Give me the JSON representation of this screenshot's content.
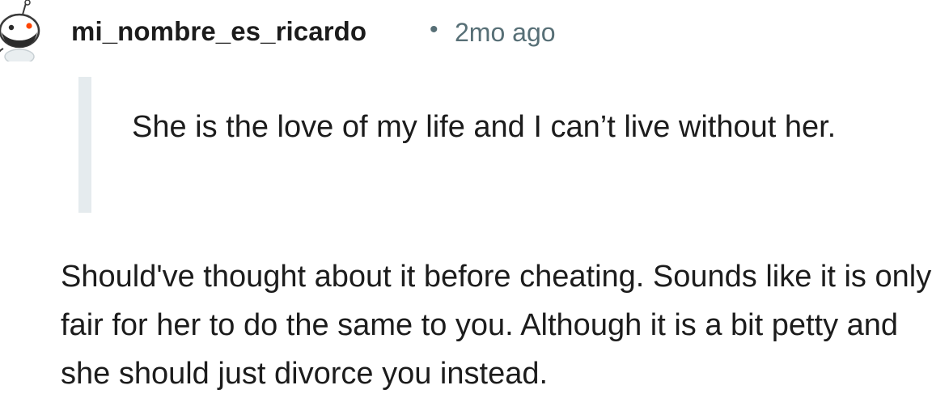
{
  "comment": {
    "author": "mi_nombre_es_ricardo",
    "separator": "•",
    "timestamp": "2mo ago",
    "avatar_icon": "snoo-avatar-icon",
    "quote": {
      "text": "She is the love of my life and I can’t live without her."
    },
    "body": "Should've thought about it before cheating. Sounds like it is only fair for her to do the same to you. Although it is a bit petty and she should just divorce you instead."
  },
  "colors": {
    "text": "#1c1c1c",
    "meta": "#576f76",
    "quote_bar": "#e5ebee",
    "avatar_accent": "#ff4500"
  }
}
